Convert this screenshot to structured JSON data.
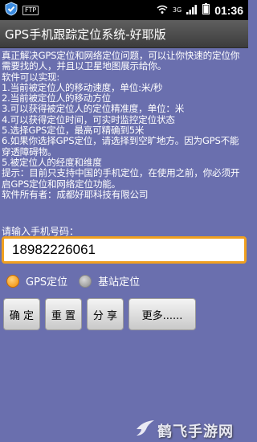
{
  "status_bar": {
    "ftp_label": "FTP",
    "network_label": "3G",
    "time": "01:36",
    "icons": [
      "shield-check-icon",
      "ftp-icon",
      "wifi-icon",
      "3g-signal-icon",
      "signal-bars-icon",
      "battery-icon"
    ]
  },
  "app": {
    "title": "GPS手机跟踪定位系统-好耶版"
  },
  "description": "真正解决GPS定位和网络定位问题，可以让你快速的定位你需要找的人，并且以卫星地图展示给你。\n软件可以实现:\n1.当前被定位人的移动速度，单位:米/秒\n2.当前被定位人的移动方位\n3.可以获得被定位人的定位精准度，单位：米\n4.可以获得定位时间，可实时监控定位状态\n5.选择GPS定位，最高可精确到5米\n6.如果你选择GPS定位，请选择到空旷地方。因为GPS不能穿透障碍物。\n5.被定位人的经度和维度\n提示：目前只支持中国的手机定位，在使用之前，你必须开启GPS定位和网络定位功能。\n软件所有者：成都好耶科技有限公司",
  "form": {
    "prompt": "请输入手机号码：",
    "phone_value": "18982226061"
  },
  "location_mode": {
    "options": [
      "GPS定位",
      "基站定位"
    ],
    "selected": "GPS定位"
  },
  "buttons": {
    "confirm": "确 定",
    "reset": "重 置",
    "share": "分 享",
    "more": "更多......"
  },
  "watermark": "鹤飞手游网",
  "colors": {
    "background": "#6a6fae",
    "accent": "#f0a020",
    "titlebar": "#4a4a4a"
  }
}
